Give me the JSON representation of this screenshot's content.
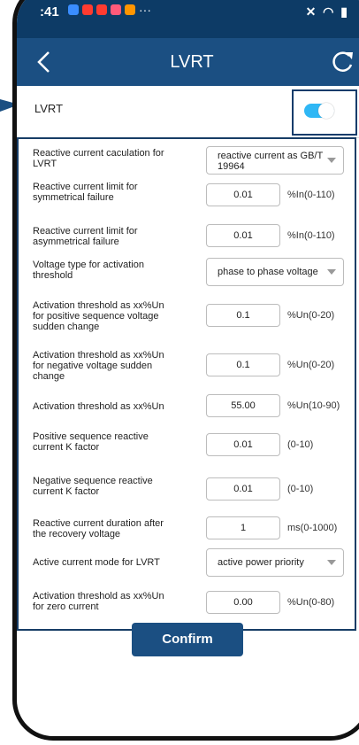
{
  "status_bar": {
    "time": ":41",
    "dots": "···",
    "app_icons": [
      "#3a8dff",
      "#ff3b30",
      "#ff3b30",
      "#ff5a7a",
      "#ff9500"
    ]
  },
  "nav": {
    "title": "LVRT"
  },
  "lvrt": {
    "label": "LVRT",
    "enabled": true
  },
  "rows": [
    {
      "label": "Reactive current caculation for LVRT",
      "type": "select",
      "value": "reactive current as GB/T 19964"
    },
    {
      "label": "Reactive current limit for symmetrical failure",
      "type": "input",
      "value": "0.01",
      "unit": "%In(0-110)"
    },
    {
      "label": "Reactive current limit for asymmetrical failure",
      "type": "input",
      "value": "0.01",
      "unit": "%In(0-110)"
    },
    {
      "label": "Voltage type for activation threshold",
      "type": "select",
      "value": "phase to phase voltage"
    },
    {
      "label": "Activation threshold as xx%Un for positive sequence voltage sudden change",
      "type": "input",
      "value": "0.1",
      "unit": "%Un(0-20)"
    },
    {
      "label": "Activation threshold as xx%Un for negative voltage sudden change",
      "type": "input",
      "value": "0.1",
      "unit": "%Un(0-20)"
    },
    {
      "label": "Activation threshold as xx%Un",
      "type": "input",
      "value": "55.00",
      "unit": "%Un(10-90)"
    },
    {
      "label": "Positive sequence reactive current K factor",
      "type": "input",
      "value": "0.01",
      "unit": "(0-10)"
    },
    {
      "label": "Negative sequence reactive current K factor",
      "type": "input",
      "value": "0.01",
      "unit": "(0-10)"
    },
    {
      "label": "Reactive current duration after the recovery voltage",
      "type": "input",
      "value": "1",
      "unit": "ms(0-1000)"
    },
    {
      "label": "Active current mode for LVRT",
      "type": "select",
      "value": "active power priority"
    },
    {
      "label": "Activation threshold as xx%Un for zero current",
      "type": "input",
      "value": "0.00",
      "unit": "%Un(0-80)"
    }
  ],
  "confirm_label": "Confirm",
  "colors": {
    "nav": "#1b4f82",
    "status": "#0d3b66",
    "toggle": "#2fb7f5"
  }
}
